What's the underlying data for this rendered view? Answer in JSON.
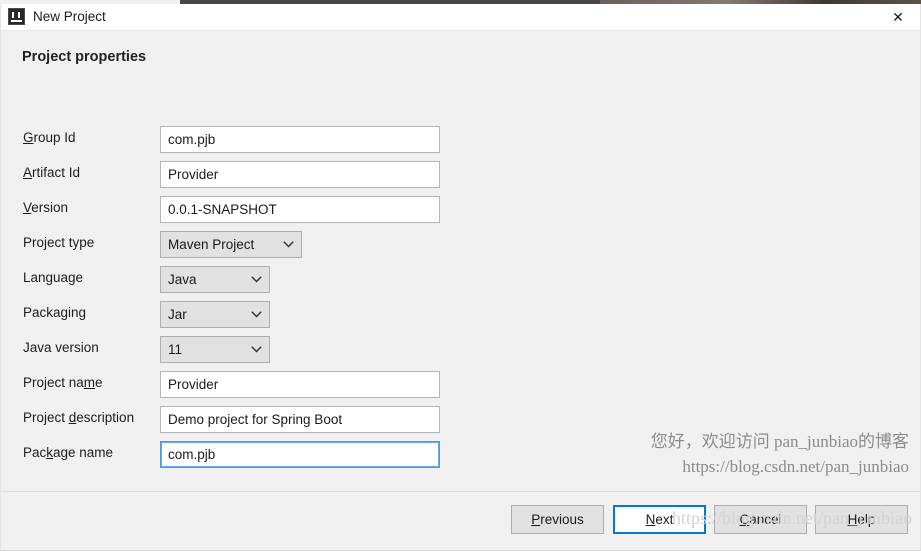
{
  "window": {
    "title": "New Project",
    "icon": "intellij-idea-icon",
    "close_label": "✕"
  },
  "content": {
    "section_title": "Project properties",
    "rows": [
      {
        "label_pre": "",
        "label_mnemonic": "G",
        "label_post": "roup Id",
        "control": "text",
        "value": "com.pjb"
      },
      {
        "label_pre": "",
        "label_mnemonic": "A",
        "label_post": "rtifact Id",
        "control": "text",
        "value": "Provider"
      },
      {
        "label_pre": "",
        "label_mnemonic": "V",
        "label_post": "ersion",
        "control": "text",
        "value": "0.0.1-SNAPSHOT"
      },
      {
        "label_pre": "Project type",
        "label_mnemonic": "",
        "label_post": "",
        "control": "combo",
        "value": "Maven Project",
        "width": "maven"
      },
      {
        "label_pre": "Language",
        "label_mnemonic": "",
        "label_post": "",
        "control": "combo",
        "value": "Java",
        "width": "std"
      },
      {
        "label_pre": "Packaging",
        "label_mnemonic": "",
        "label_post": "",
        "control": "combo",
        "value": "Jar",
        "width": "std"
      },
      {
        "label_pre": "Java version",
        "label_mnemonic": "",
        "label_post": "",
        "control": "combo",
        "value": "11",
        "width": "std"
      },
      {
        "label_pre": "Project na",
        "label_mnemonic": "m",
        "label_post": "e",
        "control": "text",
        "value": "Provider"
      },
      {
        "label_pre": "Project ",
        "label_mnemonic": "d",
        "label_post": "escription",
        "control": "text",
        "value": "Demo project for Spring Boot"
      },
      {
        "label_pre": "Pac",
        "label_mnemonic": "k",
        "label_post": "age name",
        "control": "text",
        "value": "com.pjb",
        "focused": true
      }
    ],
    "watermark_line1": "您好，欢迎访问 pan_junbiao的博客",
    "watermark_line2": "https://blog.csdn.net/pan_junbiao"
  },
  "footer": {
    "buttons": [
      {
        "label_pre": "",
        "label_mnemonic": "P",
        "label_post": "revious",
        "default": false
      },
      {
        "label_pre": "",
        "label_mnemonic": "N",
        "label_post": "ext",
        "default": true
      },
      {
        "label_pre": "",
        "label_mnemonic": "C",
        "label_post": "ancel",
        "default": false
      },
      {
        "label_pre": "",
        "label_mnemonic": "H",
        "label_post": "elp",
        "default": false
      }
    ],
    "watermark": "https://blog.csdn.net/pan_junbiao"
  },
  "colors": {
    "panel_bg": "#f0f0f0",
    "titlebar_bg": "#ffffff",
    "field_bg": "#ffffff",
    "combo_bg": "#e1e1e1",
    "focus_blue": "#0078d7",
    "field_focus_blue": "#4f9ada",
    "text": "#1a1a1a",
    "watermark_grey": "#8c8c8c"
  }
}
